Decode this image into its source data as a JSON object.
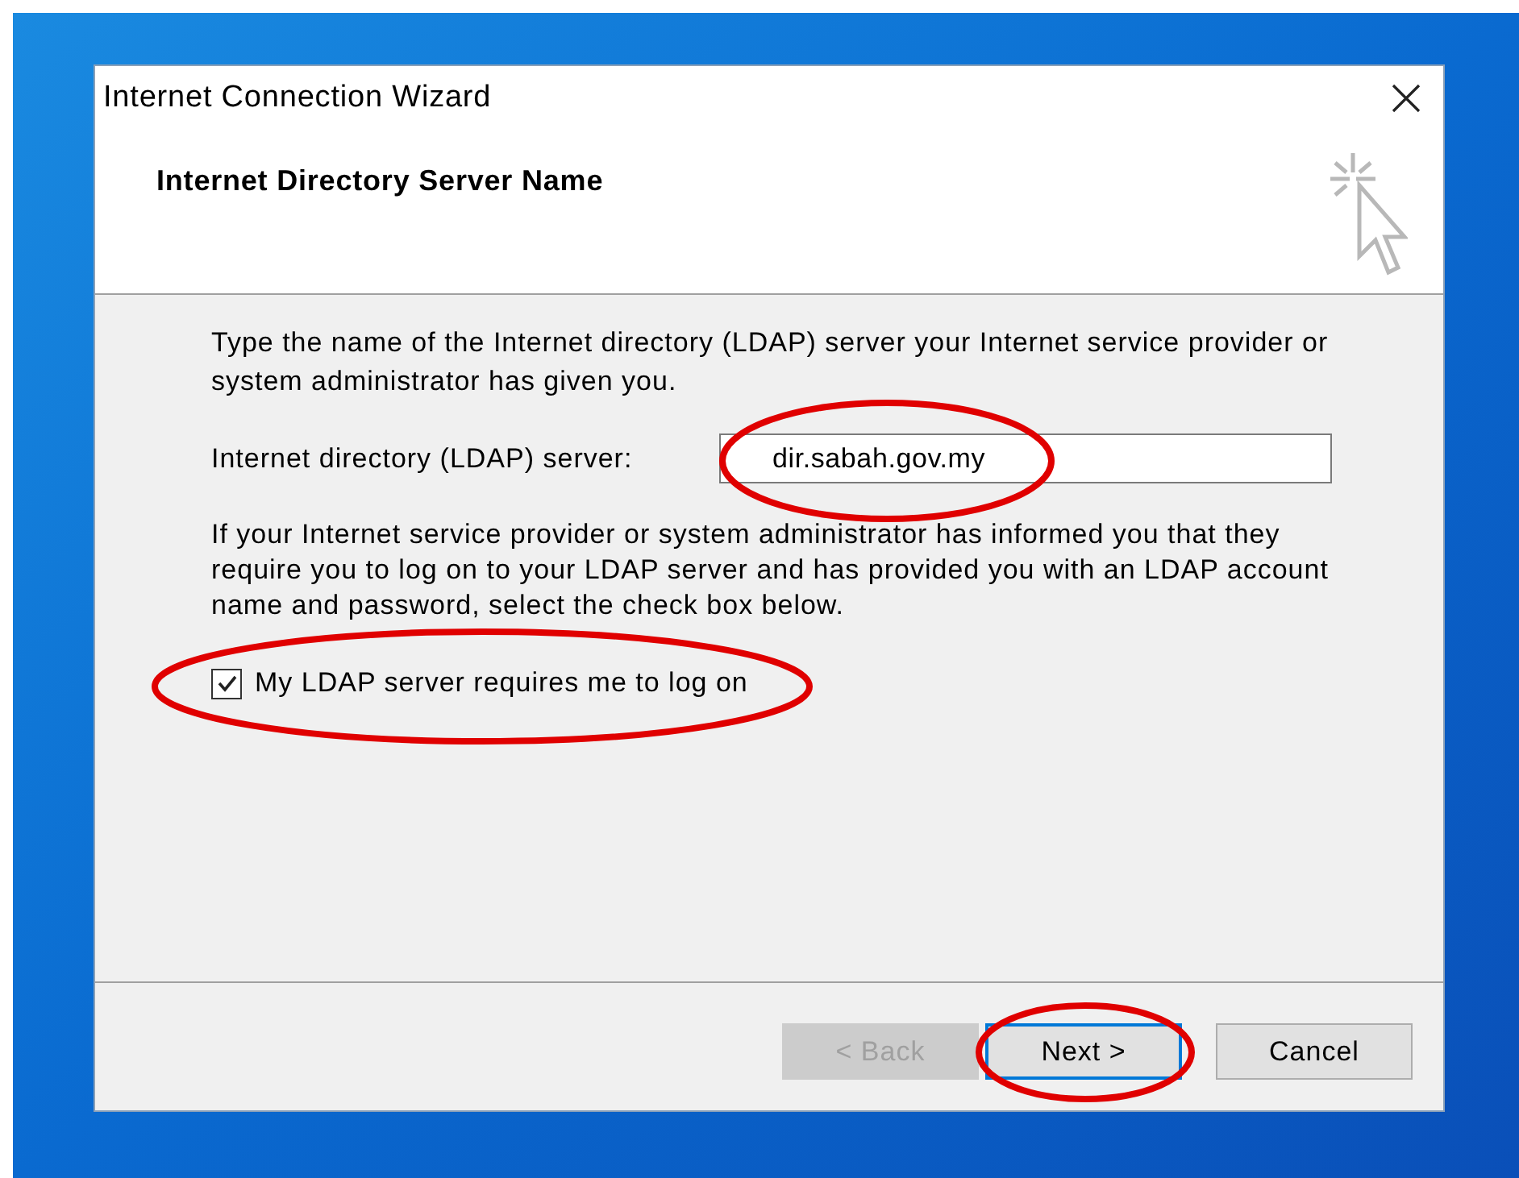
{
  "window": {
    "title": "Internet Connection Wizard"
  },
  "header": {
    "title": "Internet Directory Server Name"
  },
  "intro": "Type the name of the Internet directory (LDAP) server your Internet service provider or system administrator has given you.",
  "server_field": {
    "label": "Internet directory (LDAP) server:",
    "value": "dir.sabah.gov.my"
  },
  "info": "If your Internet service provider or system administrator has informed you that they require you to log on to your LDAP server and has provided you with an LDAP account name and password, select the check box below.",
  "logon_checkbox": {
    "label": "My LDAP server requires me to log on",
    "checked": true
  },
  "buttons": [
    {
      "label": "< Back",
      "disabled": true,
      "focused": false
    },
    {
      "label": "Next >",
      "disabled": false,
      "focused": true
    },
    {
      "label": "Cancel",
      "disabled": false,
      "focused": false
    }
  ]
}
